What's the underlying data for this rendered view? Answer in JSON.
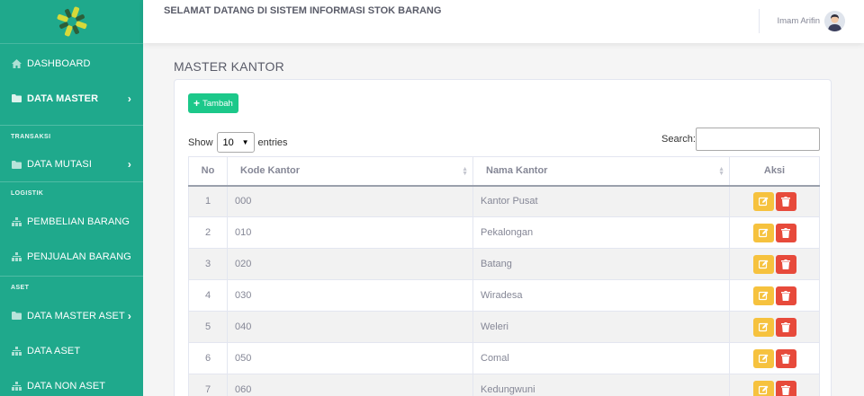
{
  "topbar": {
    "welcome": "SELAMAT DATANG DI SISTEM INFORMASI STOK BARANG",
    "username": "Imam Arifin"
  },
  "sidebar": {
    "items": [
      {
        "label": "DASHBOARD",
        "icon": "home-icon"
      },
      {
        "label": "DATA MASTER",
        "icon": "folder-icon"
      },
      {
        "label": "DATA MUTASI",
        "icon": "folder-icon"
      },
      {
        "label": "PEMBELIAN BARANG",
        "icon": "sitemap-icon"
      },
      {
        "label": "PENJUALAN BARANG",
        "icon": "sitemap-icon"
      },
      {
        "label": "DATA MASTER ASET",
        "icon": "folder-icon"
      },
      {
        "label": "DATA ASET",
        "icon": "sitemap-icon"
      },
      {
        "label": "DATA NON ASET",
        "icon": "sitemap-icon"
      }
    ],
    "sections": {
      "transaksi": "TRANSAKSI",
      "logistik": "LOGISTIK",
      "aset": "ASET"
    }
  },
  "main": {
    "title": "MASTER KANTOR",
    "add_button": "Tambah",
    "show_label": "Show",
    "entries_value": "10",
    "entries_label": "entries",
    "search_label": "Search:",
    "search_value": ""
  },
  "table": {
    "headers": {
      "no": "No",
      "kode": "Kode Kantor",
      "nama": "Nama Kantor",
      "aksi": "Aksi"
    },
    "rows": [
      {
        "no": "1",
        "kode": "000",
        "nama": "Kantor Pusat"
      },
      {
        "no": "2",
        "kode": "010",
        "nama": "Pekalongan"
      },
      {
        "no": "3",
        "kode": "020",
        "nama": "Batang"
      },
      {
        "no": "4",
        "kode": "030",
        "nama": "Wiradesa"
      },
      {
        "no": "5",
        "kode": "040",
        "nama": "Weleri"
      },
      {
        "no": "6",
        "kode": "050",
        "nama": "Comal"
      },
      {
        "no": "7",
        "kode": "060",
        "nama": "Kedungwuni"
      }
    ]
  },
  "colors": {
    "sidebar": "#1fa98c",
    "add_button": "#1cc88a",
    "edit_button": "#f6c23e",
    "delete_button": "#e74a3b"
  }
}
